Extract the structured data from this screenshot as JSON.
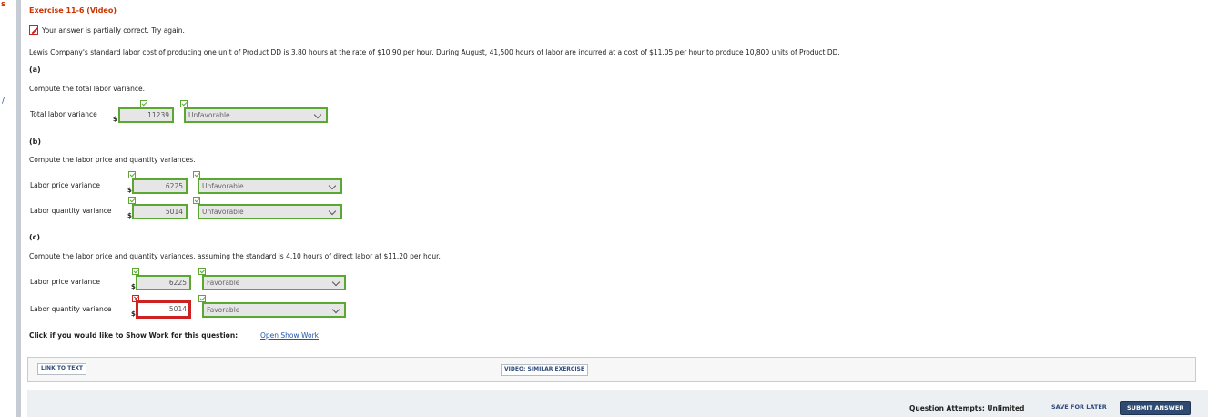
{
  "sidebar": {
    "mark_s": "s",
    "mark_slash": "/"
  },
  "exercise": {
    "title": "Exercise 11-6 (Video)",
    "status": "Your answer is partially correct.  Try again.",
    "problem": "Lewis Company's standard labor cost of producing one unit of Product DD is 3.80 hours at the rate of $10.90 per hour. During August, 41,500 hours of labor are incurred at a cost of $11.05 per hour to produce 10,800 units of Product DD."
  },
  "part_a": {
    "label": "(a)",
    "instruction": "Compute the total labor variance.",
    "row": {
      "label": "Total labor variance",
      "currency": "$",
      "value": "11239",
      "selection": "Unfavorable",
      "value_status": "correct",
      "selection_status": "correct"
    }
  },
  "part_b": {
    "label": "(b)",
    "instruction": "Compute the labor price and quantity variances.",
    "rows": [
      {
        "label": "Labor price variance",
        "currency": "$",
        "value": "6225",
        "selection": "Unfavorable",
        "value_status": "correct",
        "selection_status": "correct"
      },
      {
        "label": "Labor quantity variance",
        "currency": "$",
        "value": "5014",
        "selection": "Unfavorable",
        "value_status": "correct",
        "selection_status": "correct"
      }
    ]
  },
  "part_c": {
    "label": "(c)",
    "instruction": "Compute the labor price and quantity variances, assuming the standard is 4.10 hours of direct labor at $11.20 per hour.",
    "rows": [
      {
        "label": "Labor price variance",
        "currency": "$",
        "value": "6225",
        "selection": "Favorable",
        "value_status": "correct",
        "selection_status": "correct"
      },
      {
        "label": "Labor quantity variance",
        "currency": "$",
        "value": "5014",
        "selection": "Favorable",
        "value_status": "incorrect",
        "selection_status": "correct"
      }
    ]
  },
  "show_work": {
    "prompt": "Click if you would like to Show Work for this question:",
    "link": "Open Show Work"
  },
  "links": {
    "link_to_text": "LINK TO TEXT",
    "video": "VIDEO: SIMILAR EXERCISE"
  },
  "footer": {
    "attempts": "Question Attempts: Unlimited",
    "save": "SAVE FOR LATER",
    "submit": "SUBMIT ANSWER"
  },
  "colors": {
    "correct_border": "#5aa832",
    "incorrect_border": "#cc2222",
    "title": "#cc3300",
    "submit_bg": "#2f4a70"
  }
}
